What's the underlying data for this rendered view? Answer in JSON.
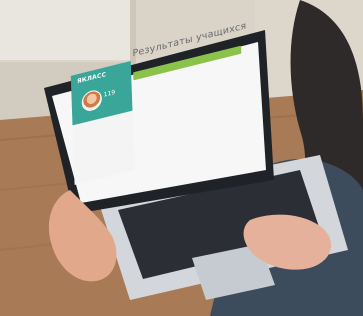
{
  "screen": {
    "logo_text": "ЯКЛАСС",
    "score": "119",
    "page_title": "Результаты учащихся"
  },
  "colors": {
    "brand_teal": "#3aa69a",
    "accent_green": "#8bc34a",
    "link_blue": "#4a8ddf"
  }
}
